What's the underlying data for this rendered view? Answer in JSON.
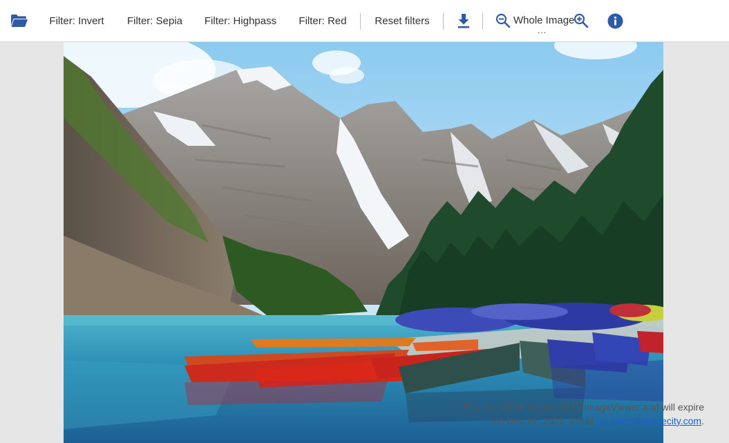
{
  "toolbar": {
    "filters": [
      {
        "label": "Filter: Invert"
      },
      {
        "label": "Filter: Sepia"
      },
      {
        "label": "Filter: Highpass"
      },
      {
        "label": "Filter: Red"
      }
    ],
    "reset_label": "Reset filters",
    "zoom_label": "Whole Image",
    "zoom_more": "...",
    "icon_color": "#2e5aa8"
  },
  "beta_notice": {
    "text_1": "This is a BETA version of GcImageViewer and will expire on Dec 31, 2022. Email ",
    "email": "us.sales@grapecity.com",
    "text_2": "."
  }
}
